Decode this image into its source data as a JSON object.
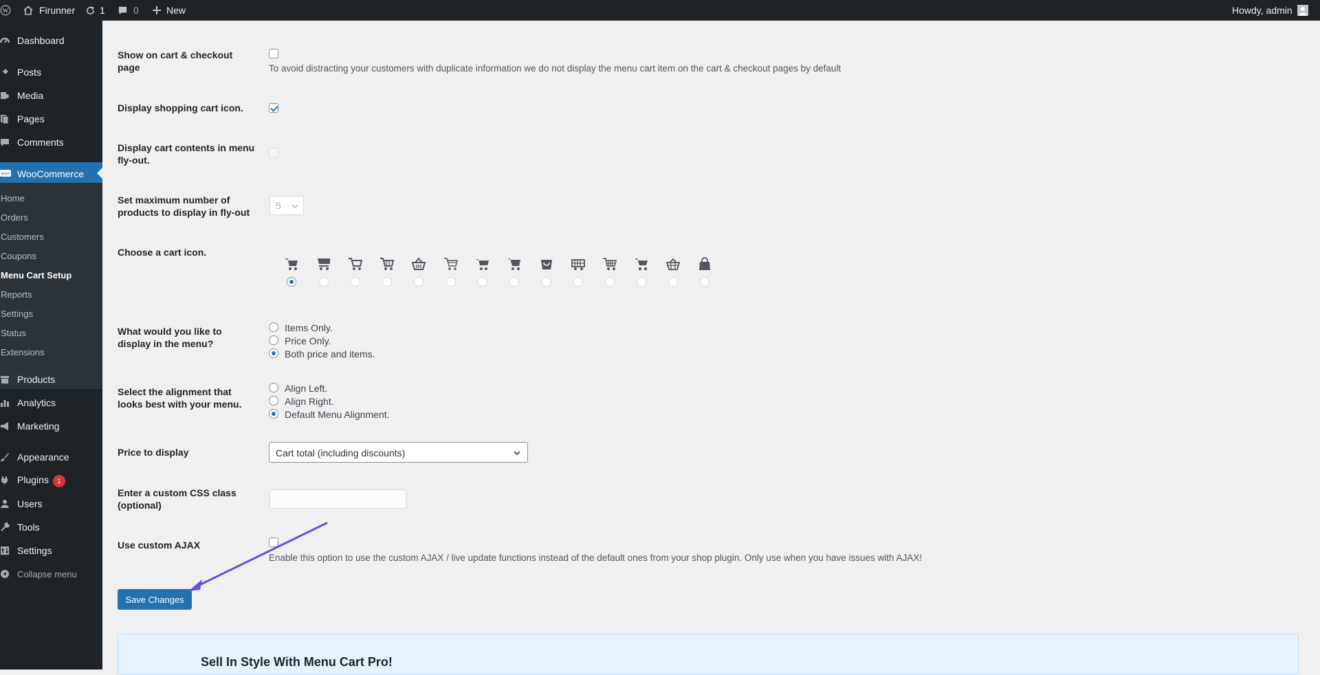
{
  "adminbar": {
    "site_name": "Firunner",
    "updates_count": "1",
    "comments_count": "0",
    "new_label": "New",
    "howdy": "Howdy, admin"
  },
  "sidebar": {
    "dashboard": "Dashboard",
    "posts": "Posts",
    "media": "Media",
    "pages": "Pages",
    "comments": "Comments",
    "woocommerce": "WooCommerce",
    "submenu": [
      "Home",
      "Orders",
      "Customers",
      "Coupons",
      "Menu Cart Setup",
      "Reports",
      "Settings",
      "Status",
      "Extensions"
    ],
    "products": "Products",
    "analytics": "Analytics",
    "marketing": "Marketing",
    "appearance": "Appearance",
    "plugins": "Plugins",
    "plugins_badge": "1",
    "users": "Users",
    "tools": "Tools",
    "settings": "Settings",
    "collapse": "Collapse menu"
  },
  "form": {
    "show_cart_label": "Show on cart & checkout page",
    "show_cart_desc": "To avoid distracting your customers with duplicate information we do not display the menu cart item on the cart & checkout pages by default",
    "display_icon_label": "Display shopping cart icon.",
    "flyout_label": "Display cart contents in menu fly-out.",
    "max_products_label": "Set maximum number of products to display in fly-out",
    "max_products_value": "5",
    "cart_icon_label": "Choose a cart icon.",
    "display_label": "What would you like to display in the menu?",
    "display_options": [
      "Items Only.",
      "Price Only.",
      "Both price and items."
    ],
    "alignment_label": "Select the alignment that looks best with your menu.",
    "alignment_options": [
      "Align Left.",
      "Align Right.",
      "Default Menu Alignment."
    ],
    "price_label": "Price to display",
    "price_value": "Cart total (including discounts)",
    "css_label": "Enter a custom CSS class (optional)",
    "css_value": "",
    "ajax_label": "Use custom AJAX",
    "ajax_desc": "Enable this option to use the custom AJAX / live update functions instead of the default ones from your shop plugin. Only use when you have issues with AJAX!",
    "save_label": "Save Changes"
  },
  "promo": {
    "title": "Sell In Style With Menu Cart Pro!"
  },
  "colors": {
    "admin_bg": "#1d2327",
    "accent": "#2271b1",
    "arrow": "#6b4fd8"
  }
}
